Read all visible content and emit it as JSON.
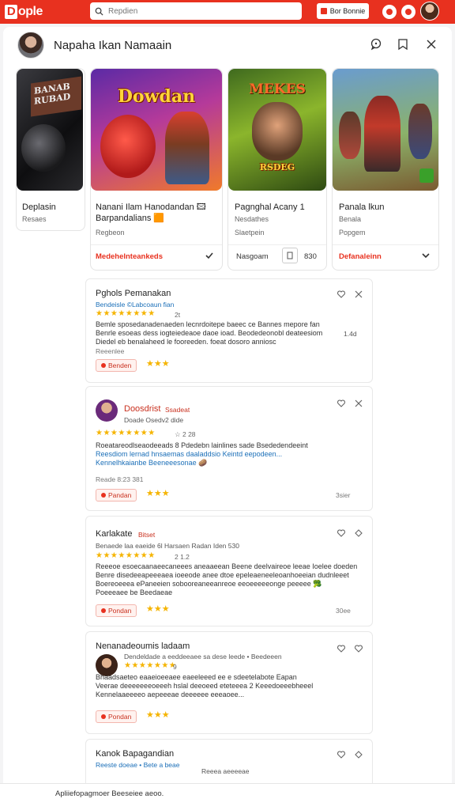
{
  "topbar": {
    "logo_text": "ople",
    "logo_letter": "D",
    "search_placeholder": "Repdien",
    "button_label": "Bor Bonnie",
    "accent": "#e8311f"
  },
  "header": {
    "title": "Napaha Ikan Namaain"
  },
  "cards": [
    {
      "title": "Deplasin",
      "subtitle": "Resaes"
    },
    {
      "art_title": "Dowdan",
      "title": "Nanani Ilam Hanodandan  🖾",
      "title2": "Barpandalians 🟧",
      "subtitle": "Regbeon",
      "action": "Medehelnteankeds"
    },
    {
      "art_title": "MEKES",
      "art_sub": "RSDEG",
      "title": "Pagnghal Acany 1",
      "subtitle": "Nesdathes",
      "meta": "Slaetpein",
      "action": "Nasgoam",
      "count": "830"
    },
    {
      "title": "Panala lkun",
      "subtitle": "Benala",
      "meta": "Popgem",
      "action": "Defanaleinn"
    }
  ],
  "reviews": [
    {
      "name": "Pghols Pemanakan",
      "meta": "Bendeisle ©Labcoaun fian",
      "stars": "★★★★★★★★",
      "star_label": "2t",
      "body": [
        "Bemle sposedanadenaeden lecnrdoitepe baeec ce Bannes mepore fan",
        "Benrle esoeas dess iogteiedeaoe daoe ioad. Beodedeonobl deateesiom",
        "Diedel eb benalaheed le fooreeden. foeat dosoro anniosc"
      ],
      "extra": "1.4d",
      "foot": "Reeenlee",
      "pill": "Benden",
      "mini": "★★★"
    },
    {
      "name": "Doosdrist",
      "name_sub": "Ssadeat",
      "meta": "Doade Osedv2 dide",
      "stars": "★★★★★★★★",
      "star_label": "☆ 2 28",
      "body": [
        "Roeatareodlseaodeeads 8 Pdedebn lainlines sade Bsededendeeint",
        "Reesdiom lernad hnsaemas daaladdsio Keintd eepodeen...",
        "Kennelhkaianbe Beeneeesonae 🥔"
      ],
      "foot": "Reade 8:23 381",
      "pill": "Pandan",
      "mini": "★★★",
      "right": "3sier"
    },
    {
      "name": "Karlakate",
      "name_sub": "Bitset",
      "meta": "Benaede laa eaeide 6l Harsaen Radan Iden 530",
      "stars": "★★★★★★★★",
      "star_label": "2 1.2",
      "body": [
        "Reeeoe esoecaanaeecaneees aneaaeean Beene deelvaireoe leeae Ioelee doeden",
        "Benre disedeeapeeeaea ioeeode anee dtoe epeleaeneeleoanhoeeian dudnleeet",
        "Boereoeeea ePaneeien sobooreaneeanreoe eeoeeeeeonge peeeee 🥦",
        "Poeeeaee be Beedaeae"
      ],
      "pill": "Pondan",
      "mini": "★★★",
      "right": "30ee"
    },
    {
      "name": "Nenanadeoumis ladaam",
      "meta": "Dendeldade a eeddeeaee sa dese leede • Beedeeen",
      "stars": "★★★★★★★",
      "star_label": "9",
      "body": [
        "Bhaadsaeteo eaaeioeeaee eaeeleeed ee e sdeetelabote Eapan",
        "Veerae deeeeeeeoeeeh hslal deeoeed eteteeea 2 Keeedoeeebheeel",
        "Kennelaaeeeeo aepeeeae deeeeee eeeaoee..."
      ],
      "pill": "Pondan",
      "mini": "★★★"
    },
    {
      "name": "Kanok Bapagandian",
      "meta": "Reeste doeae • Bete a beae",
      "extra": "Reeea aeeeeae"
    }
  ],
  "footer": {
    "text": "Apliiefopagmoer Beeseiee aeoo."
  }
}
